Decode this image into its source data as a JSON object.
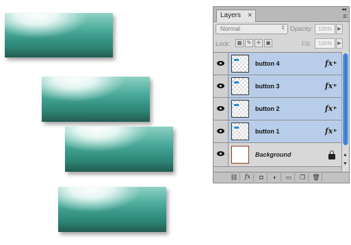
{
  "panel": {
    "tab_label": "Layers",
    "tab_close": "✕",
    "collapse_glyph": "◂◂",
    "menu_glyph": "≡",
    "blend_mode": "Normal",
    "blend_arrow": "⇕",
    "opacity_label": "Opacity:",
    "opacity_value": "100%",
    "lock_label": "Lock:",
    "fill_label": "Fill:",
    "fill_value": "100%",
    "field_arrow": "▶"
  },
  "layers": [
    {
      "name": "button 4",
      "fx": "fx",
      "selected": true
    },
    {
      "name": "button 3",
      "fx": "fx",
      "selected": true
    },
    {
      "name": "button 2",
      "fx": "fx",
      "selected": true
    },
    {
      "name": "button 1",
      "fx": "fx",
      "selected": true
    },
    {
      "name": "Background",
      "locked": true,
      "selected": false
    }
  ],
  "bottom_icons": [
    "link-icon",
    "fx-icon",
    "mask-icon",
    "adjustment-icon",
    "group-icon",
    "new-layer-icon",
    "trash-icon"
  ],
  "bottom_labels": {
    "fx": "fx"
  },
  "colors": {
    "selected_row": "#b8cde9",
    "button_teal": "#2f8b7b",
    "button_highlight": "#ffffff",
    "scroll_blue": "#2f74cf"
  }
}
